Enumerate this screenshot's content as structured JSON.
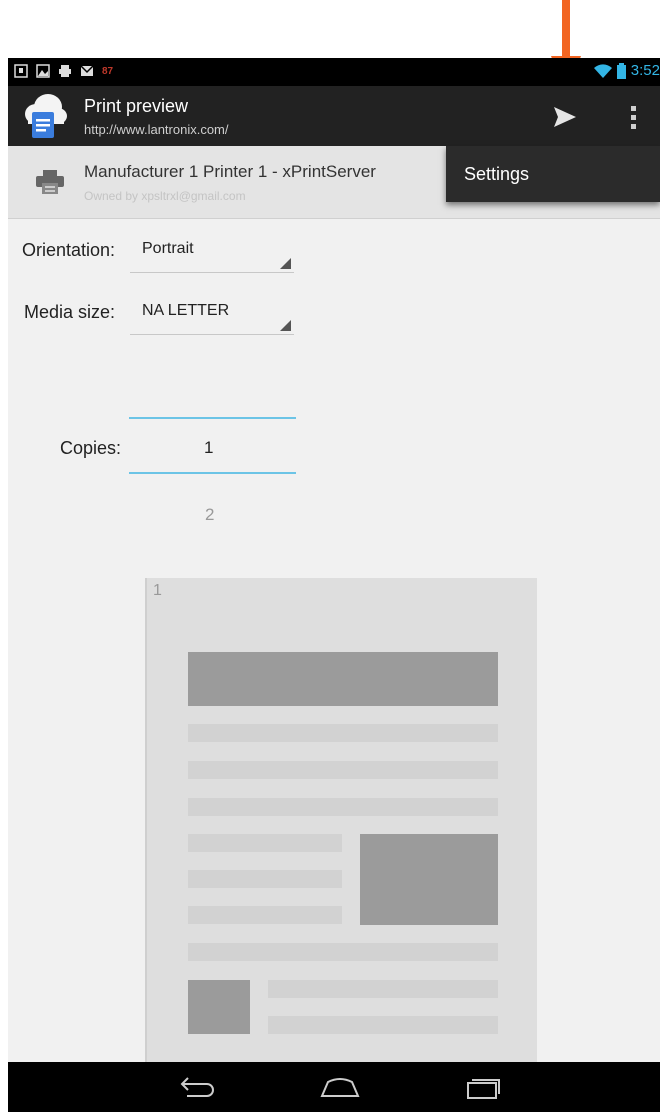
{
  "status_bar": {
    "time": "3:52",
    "badge": "87",
    "icons": [
      "download-icon",
      "image-icon",
      "print-icon",
      "gmail-icon",
      "wifi-icon",
      "battery-icon"
    ]
  },
  "action_bar": {
    "title": "Print preview",
    "url": "http://www.lantronix.com/",
    "icons": [
      "cloud-print-icon",
      "send-icon",
      "overflow-menu-icon"
    ]
  },
  "printer": {
    "name": "Manufacturer 1 Printer 1 - xPrintServer",
    "owner": "Owned by xpsltrxl@gmail.com"
  },
  "menu": {
    "items": [
      {
        "label": "Settings"
      }
    ]
  },
  "settings": {
    "orientation_label": "Orientation:",
    "orientation_value": "Portrait",
    "media_label": "Media size:",
    "media_value": "NA LETTER",
    "copies_label": "Copies:",
    "copies_value": "1",
    "copies_next": "2"
  },
  "preview": {
    "page_number": "1"
  },
  "nav_bar": {
    "icons": [
      "back-icon",
      "home-icon",
      "recent-apps-icon"
    ]
  },
  "colors": {
    "accent": "#33b5e5",
    "annotation_arrow": "#f26522"
  }
}
